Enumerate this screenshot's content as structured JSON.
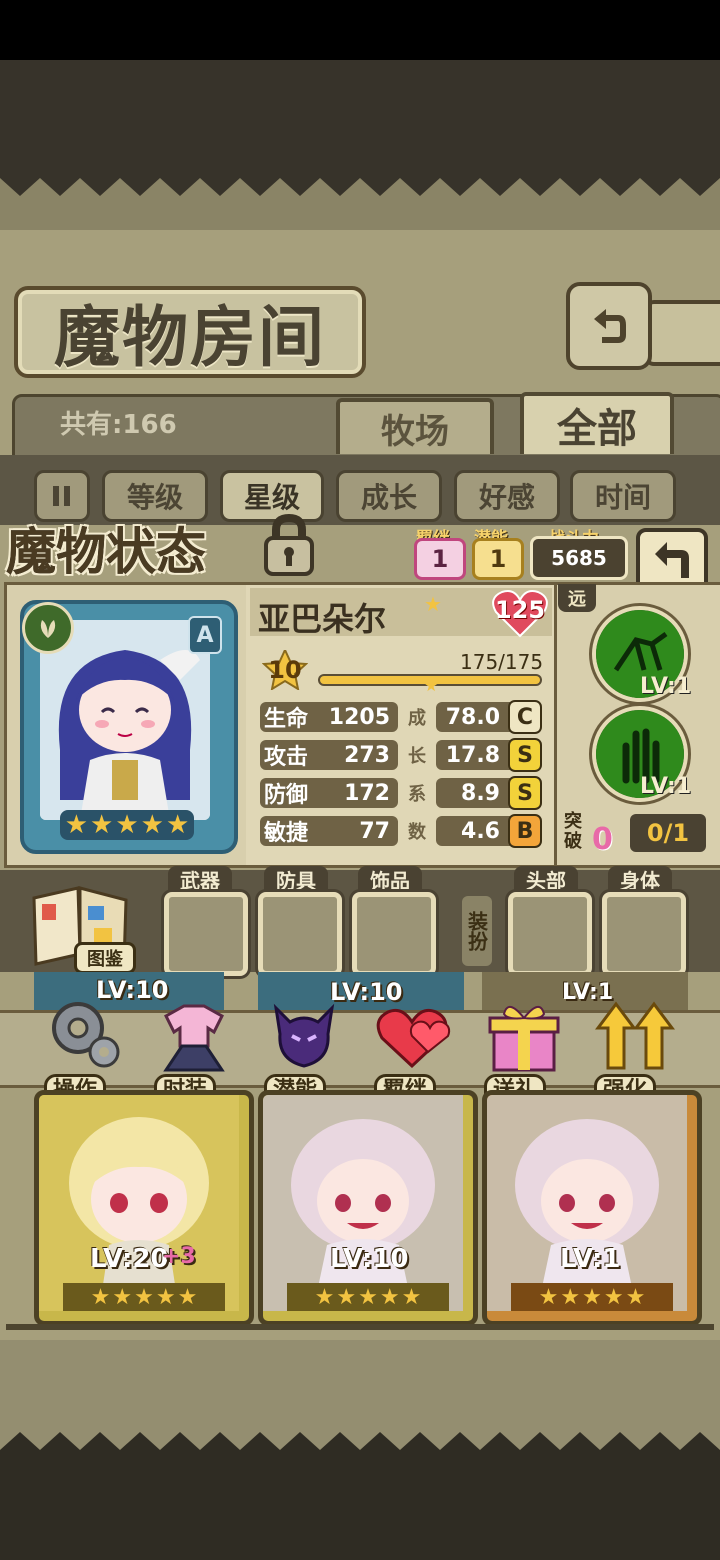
{
  "room": {
    "title": "魔物房间",
    "count": "共有:166",
    "tabs": [
      {
        "label": "牧场"
      },
      {
        "label": "全部"
      }
    ]
  },
  "filters": [
    {
      "label": "等级"
    },
    {
      "label": "星级"
    },
    {
      "label": "成长"
    },
    {
      "label": "好感"
    },
    {
      "label": "时间"
    }
  ],
  "status": {
    "title": "魔物状态",
    "bond_label": "羁绊",
    "bond_value": "1",
    "potential_label": "潜能",
    "potential_value": "1",
    "power_label": "战斗力",
    "power_value": "5685"
  },
  "monster": {
    "name": "亚巴朵尔",
    "rank_badge": "A",
    "love_value": "125",
    "level": "10",
    "exp": "175/175",
    "exp_progress": 1.0,
    "stars": 5,
    "stats": [
      {
        "label": "生命",
        "value": "1205",
        "coef": "78.0",
        "grade": "C"
      },
      {
        "label": "攻击",
        "value": "273",
        "coef": "17.8",
        "grade": "S"
      },
      {
        "label": "防御",
        "value": "172",
        "coef": "8.9",
        "grade": "S"
      },
      {
        "label": "敏捷",
        "value": "77",
        "coef": "4.6",
        "grade": "B"
      }
    ],
    "growth_vertical": [
      "成",
      "长",
      "系",
      "数"
    ],
    "range_tag": "远",
    "skills": [
      {
        "icon": "insect-skill-icon",
        "level": "LV:1"
      },
      {
        "icon": "claw-skill-icon",
        "level": "LV:1"
      }
    ],
    "breakthrough_label": "突破",
    "breakthrough_value": "0",
    "breakthrough_progress": "0/1"
  },
  "equipment": {
    "codex_label": "图鉴",
    "slots": [
      {
        "label": "武器"
      },
      {
        "label": "防具"
      },
      {
        "label": "饰品"
      },
      {
        "label": "头部"
      },
      {
        "label": "身体"
      }
    ],
    "equip_vertical": "装扮"
  },
  "actions": [
    {
      "label": "操作",
      "icon": "gear-icon"
    },
    {
      "label": "时装",
      "icon": "dress-icon"
    },
    {
      "label": "潜能",
      "icon": "demon-icon"
    },
    {
      "label": "羁绊",
      "icon": "heart-icon"
    },
    {
      "label": "送礼",
      "icon": "gift-icon"
    },
    {
      "label": "强化",
      "icon": "arrow-up-icon"
    }
  ],
  "cards": [
    {
      "level": "LV:20",
      "bonus": "+3",
      "stars": 5
    },
    {
      "level": "LV:10",
      "stars": 5
    },
    {
      "level": "LV:1",
      "stars": 5
    }
  ],
  "hidden_row_levels": [
    "LV:10",
    "LV:10",
    "LV:1"
  ],
  "colors": {
    "gold": "#f2c341",
    "pink": "#e86aa8",
    "panel": "#e0d7b6",
    "dark": "#4a4232"
  }
}
